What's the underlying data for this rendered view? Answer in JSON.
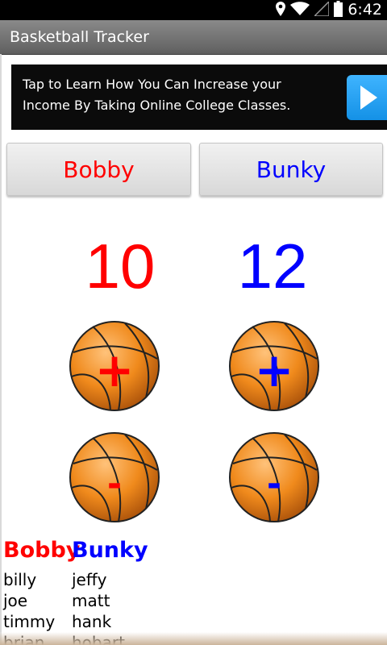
{
  "status_bar": {
    "time": "6:42",
    "icons": [
      "location-icon",
      "wifi-icon",
      "signal-icon",
      "battery-icon"
    ]
  },
  "action_bar": {
    "title": "Basketball Tracker"
  },
  "ad": {
    "line1": "Tap to Learn How You Can Increase your",
    "line2": "Income By Taking Online College Classes.",
    "icon": "play-arrow-icon"
  },
  "players": [
    {
      "name": "Bobby",
      "color": "#ff0000",
      "score": "10",
      "plus_label": "+",
      "minus_label": "-",
      "roster": [
        "billy",
        "joe",
        "timmy",
        "brian"
      ]
    },
    {
      "name": "Bunky",
      "color": "#0000ff",
      "score": "12",
      "plus_label": "+",
      "minus_label": "-",
      "roster": [
        "jeffy",
        "matt",
        "hank",
        "hobart"
      ]
    }
  ],
  "colors": {
    "ball_orange": "#f08a1c",
    "ball_dark": "#a8500a",
    "ad_accent": "#1a9cf2"
  }
}
